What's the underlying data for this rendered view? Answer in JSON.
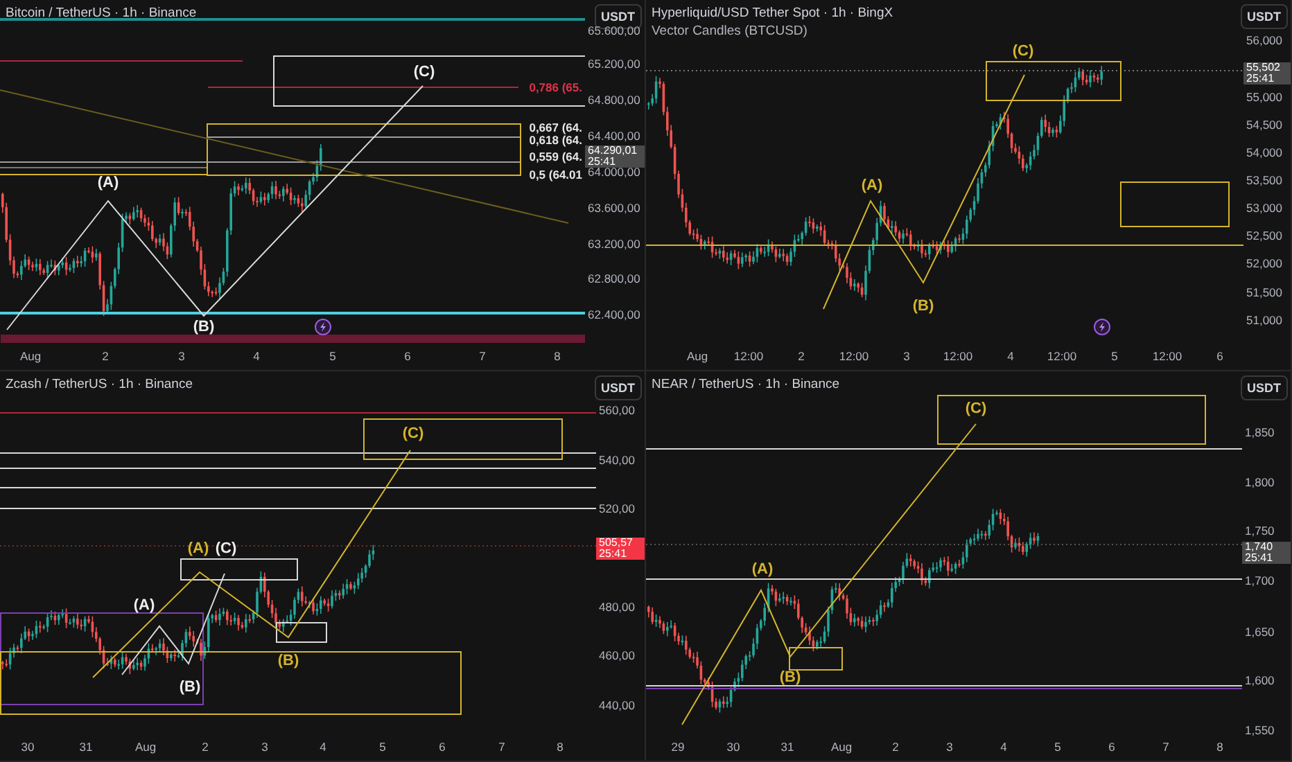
{
  "panels": [
    {
      "title": "Bitcoin / TetherUS · 1h · Binance",
      "currency": "USDT",
      "price_labels": [
        "65.600,00",
        "65.200,00",
        "64.800,00",
        "64.400,00",
        "64.000,00",
        "63.600,00",
        "63.200,00",
        "62.800,00",
        "62.400,00"
      ],
      "time_labels": [
        "Aug",
        "2",
        "3",
        "4",
        "5",
        "6",
        "7",
        "8"
      ],
      "price_tag": {
        "price": "64.290,01",
        "countdown": "25:41",
        "color": "#4a4a4a"
      },
      "fib_labels": [
        {
          "text": "0,786 (65.",
          "color": "#e0314b"
        },
        {
          "text": "0,667 (64.",
          "color": "#e6e6e6"
        },
        {
          "text": "0,618 (64.",
          "color": "#e6e6e6"
        },
        {
          "text": "0,559 (64.",
          "color": "#e6e6e6"
        },
        {
          "text": "0,5 (64.01",
          "color": "#e6e6e6"
        }
      ],
      "wave_labels": [
        {
          "text": "(C)",
          "color": "#eeeeee"
        },
        {
          "text": "(A)",
          "color": "#eeeeee"
        },
        {
          "text": "(B)",
          "color": "#eeeeee"
        }
      ]
    },
    {
      "title": "Hyperliquid/USD Tether Spot · 1h · BingX",
      "subtitle": "Vector Candles (BTCUSD)",
      "currency": "USDT",
      "price_labels": [
        "56,000",
        "55,000",
        "54,500",
        "54,000",
        "53,500",
        "53,000",
        "52,500",
        "52,000",
        "51,500",
        "51,000"
      ],
      "time_labels": [
        "Aug",
        "12:00",
        "2",
        "12:00",
        "3",
        "12:00",
        "4",
        "12:00",
        "5",
        "12:00",
        "6"
      ],
      "price_tag": {
        "price": "55,502",
        "countdown": "25:41",
        "color": "#4a4a4a"
      },
      "wave_labels": [
        {
          "text": "(C)",
          "color": "#d4b52c"
        },
        {
          "text": "(A)",
          "color": "#d4b52c"
        },
        {
          "text": "(B)",
          "color": "#d4b52c"
        }
      ]
    },
    {
      "title": "Zcash / TetherUS · 1h · Binance",
      "currency": "USDT",
      "price_labels": [
        "560,00",
        "540,00",
        "520,00",
        "480,00",
        "460,00",
        "440,00"
      ],
      "time_labels": [
        "30",
        "31",
        "Aug",
        "2",
        "3",
        "4",
        "5",
        "6",
        "7",
        "8"
      ],
      "price_tag": {
        "price": "505,57",
        "countdown": "25:41",
        "color": "#f23645"
      },
      "wave_labels": [
        {
          "text": "(C)",
          "color": "#d4b52c"
        },
        {
          "text": "(A)",
          "color": "#d4b52c"
        },
        {
          "text": "(C)",
          "color": "#eeeeee"
        },
        {
          "text": "(A)",
          "color": "#eeeeee"
        },
        {
          "text": "(B)",
          "color": "#d4b52c"
        },
        {
          "text": "(B)",
          "color": "#eeeeee"
        }
      ]
    },
    {
      "title": "NEAR / TetherUS · 1h · Binance",
      "currency": "USDT",
      "price_labels": [
        "1,850",
        "1,800",
        "1,750",
        "1,700",
        "1,650",
        "1,600",
        "1,550"
      ],
      "time_labels": [
        "29",
        "30",
        "31",
        "Aug",
        "2",
        "3",
        "4",
        "5",
        "6",
        "7",
        "8"
      ],
      "price_tag": {
        "price": "1,740",
        "countdown": "25:41",
        "color": "#4a4a4a"
      },
      "wave_labels": [
        {
          "text": "(C)",
          "color": "#d4b52c"
        },
        {
          "text": "(A)",
          "color": "#d4b52c"
        },
        {
          "text": "(B)",
          "color": "#d4b52c"
        }
      ]
    }
  ]
}
